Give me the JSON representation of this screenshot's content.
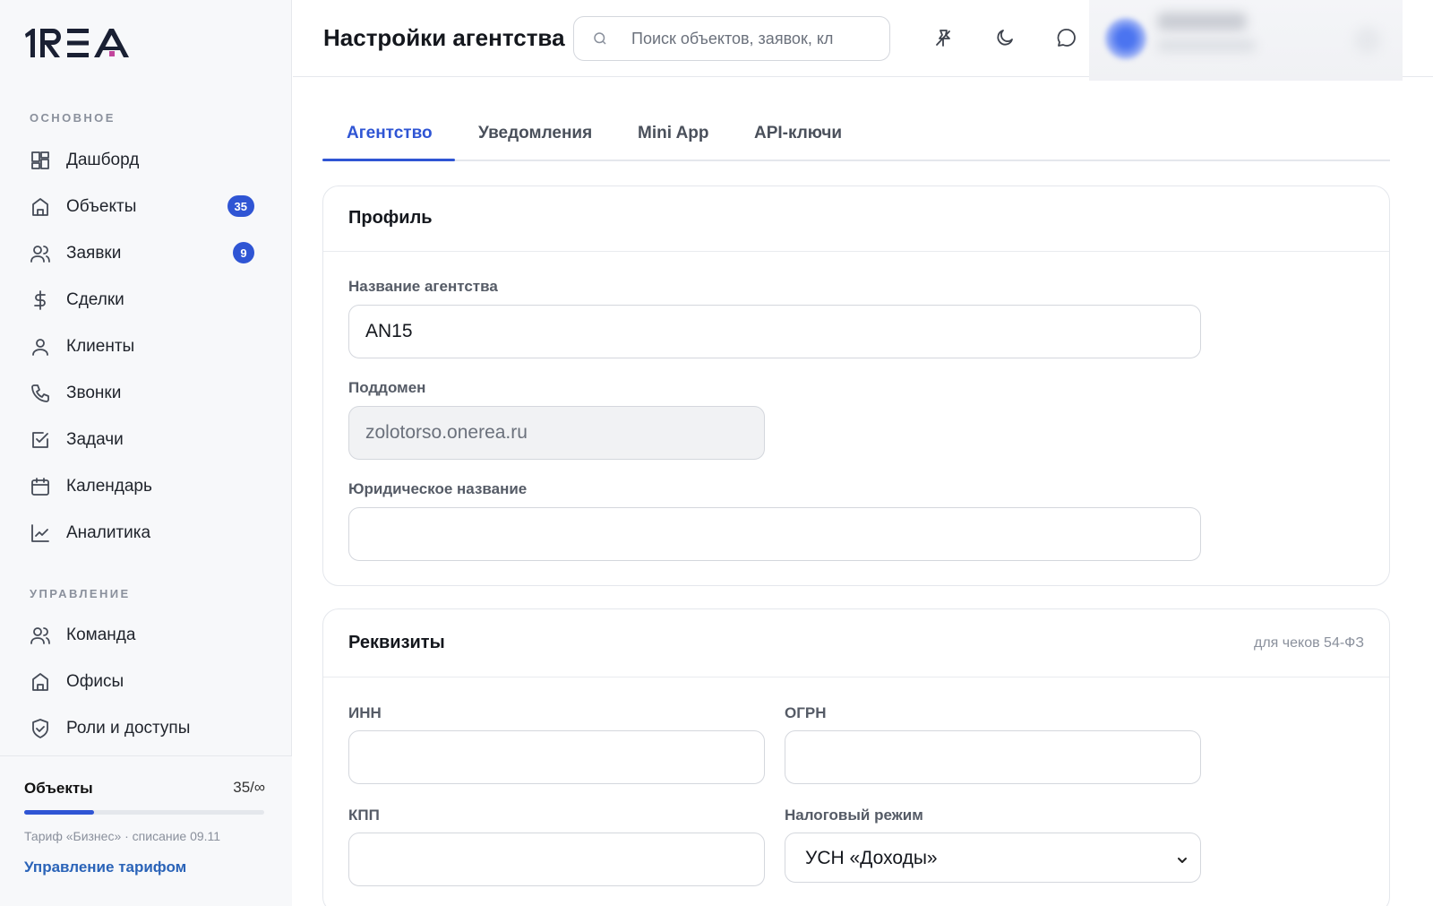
{
  "app": {
    "logo_text": "1REA"
  },
  "sidebar": {
    "sections": [
      {
        "label": "ОСНОВНОЕ"
      },
      {
        "label": "УПРАВЛЕНИЕ"
      }
    ],
    "items": [
      {
        "label": "Дашборд",
        "icon": "dashboard-icon"
      },
      {
        "label": "Объекты",
        "icon": "building-icon",
        "badge": "35"
      },
      {
        "label": "Заявки",
        "icon": "users-icon",
        "badge": "9"
      },
      {
        "label": "Сделки",
        "icon": "dollar-icon"
      },
      {
        "label": "Клиенты",
        "icon": "user-icon"
      },
      {
        "label": "Звонки",
        "icon": "phone-icon"
      },
      {
        "label": "Задачи",
        "icon": "checkbox-icon"
      },
      {
        "label": "Календарь",
        "icon": "calendar-icon"
      },
      {
        "label": "Аналитика",
        "icon": "chart-icon"
      },
      {
        "label": "Команда",
        "icon": "team-icon"
      },
      {
        "label": "Офисы",
        "icon": "office-icon"
      },
      {
        "label": "Роли и доступы",
        "icon": "shield-icon"
      }
    ],
    "plan": {
      "title": "Объекты",
      "count": "35/∞",
      "usage_fraction": 0.29,
      "subtitle": "Тариф «Бизнес» · списание 09.11",
      "link": "Управление тарифом"
    }
  },
  "header": {
    "title": "Настройки агентства",
    "search_placeholder": "Поиск объектов, заявок, кл",
    "icons": [
      "pin-off-icon",
      "moon-icon",
      "chat-icon"
    ]
  },
  "tabs": [
    {
      "label": "Агентство",
      "active": true
    },
    {
      "label": "Уведомления",
      "active": false
    },
    {
      "label": "Mini App",
      "active": false
    },
    {
      "label": "API-ключи",
      "active": false
    }
  ],
  "profile": {
    "title": "Профиль",
    "agency_name_label": "Название агентства",
    "agency_name_value": "AN15",
    "subdomain_label": "Поддомен",
    "subdomain_value": "zolotorso.onerea.ru",
    "legal_name_label": "Юридическое название",
    "legal_name_value": ""
  },
  "requisites": {
    "title": "Реквизиты",
    "hint": "для чеков 54-ФЗ",
    "inn_label": "ИНН",
    "inn_value": "",
    "ogrn_label": "ОГРН",
    "ogrn_value": "",
    "kpp_label": "КПП",
    "kpp_value": "",
    "tax_label": "Налоговый режим",
    "tax_value": "УСН «Доходы»"
  },
  "colors": {
    "accent": "#2f55d4",
    "link": "#2a63b8"
  }
}
